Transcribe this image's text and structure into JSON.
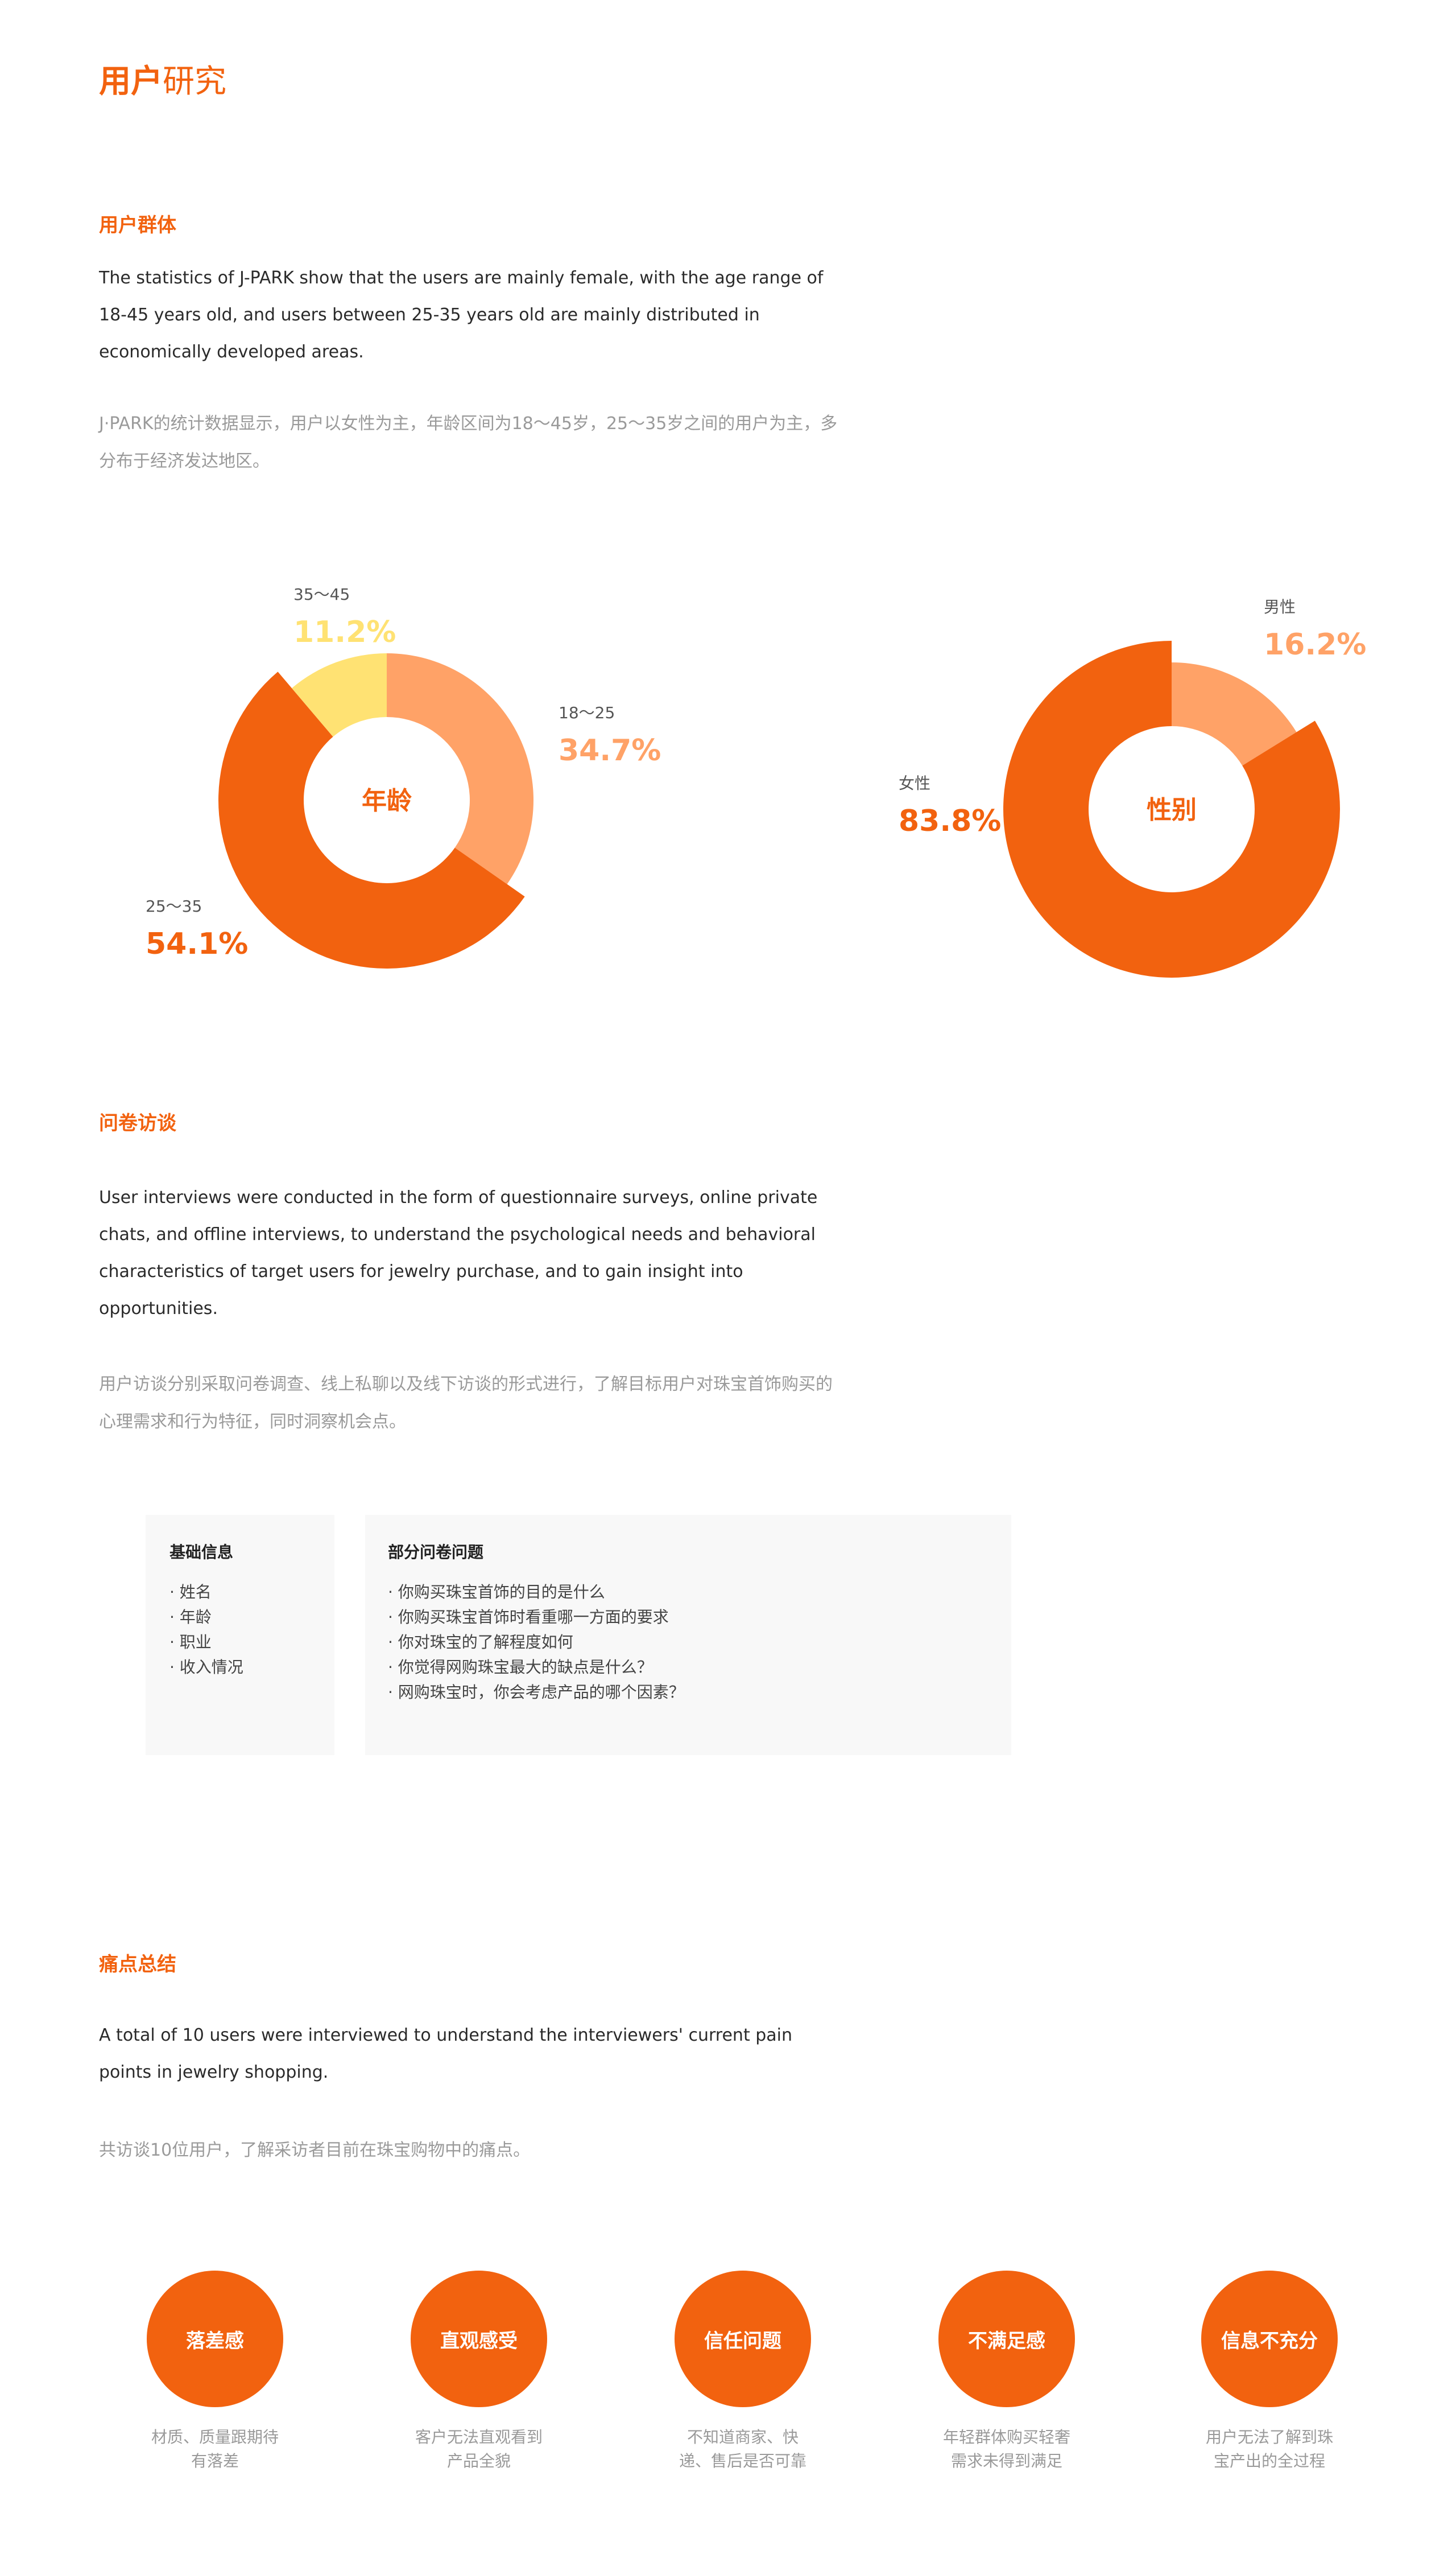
{
  "page": {
    "title_bold": "用户",
    "title_light": "研究"
  },
  "user_group": {
    "heading": "用户群体",
    "en": "The statistics of J-PARK show that the users are mainly female, with the age range of 18-45 years old, and users between 25-35 years old are mainly distributed in economically developed areas.",
    "cn": "J·PARK的统计数据显示，用户以女性为主，年龄区间为18～45岁，25～35岁之间的用户为主，多分布于经济发达地区。"
  },
  "colors": {
    "primary": "#F2620F",
    "light_orange": "#FFA267",
    "yellow": "#FFE273",
    "gray_text": "#9a9a9a",
    "card_bg": "#f8f8f8"
  },
  "chart_data": [
    {
      "type": "pie",
      "center_label": "年龄",
      "categories": [
        "18～25",
        "25～35",
        "35～45"
      ],
      "values": [
        34.7,
        54.1,
        11.2
      ],
      "value_labels": [
        "34.7%",
        "54.1%",
        "11.2%"
      ],
      "colors": [
        "#FFA267",
        "#F2620F",
        "#FFE273"
      ]
    },
    {
      "type": "pie",
      "center_label": "性别",
      "categories": [
        "男性",
        "女性"
      ],
      "values": [
        16.2,
        83.8
      ],
      "value_labels": [
        "16.2%",
        "83.8%"
      ],
      "colors": [
        "#FFA267",
        "#F2620F"
      ]
    }
  ],
  "interview": {
    "heading": "问卷访谈",
    "en": "User interviews were conducted in the form of questionnaire surveys, online private chats, and offline interviews, to understand the psychological needs and behavioral characteristics of target users for jewelry purchase, and to gain insight into opportunities.",
    "cn": "用户访谈分别采取问卷调查、线上私聊以及线下访谈的形式进行，了解目标用户对珠宝首饰购买的心理需求和行为特征，同时洞察机会点。",
    "basic_card": {
      "title": "基础信息",
      "items": [
        "· 姓名",
        "· 年龄",
        "· 职业",
        "· 收入情况"
      ]
    },
    "question_card": {
      "title": "部分问卷问题",
      "items": [
        "· 你购买珠宝首饰的目的是什么",
        "· 你购买珠宝首饰时看重哪一方面的要求",
        "· 你对珠宝的了解程度如何",
        "· 你觉得网购珠宝最大的缺点是什么？",
        "· 网购珠宝时，你会考虑产品的哪个因素？"
      ]
    }
  },
  "pain_points": {
    "heading": "痛点总结",
    "en": "A total of 10 users were interviewed to understand the interviewers' current pain points in jewelry shopping.",
    "cn": "共访谈10位用户，了解采访者目前在珠宝购物中的痛点。",
    "items": [
      {
        "label": "落差感",
        "desc1": "材质、质量跟期待",
        "desc2": "有落差"
      },
      {
        "label": "直观感受",
        "desc1": "客户无法直观看到",
        "desc2": "产品全貌"
      },
      {
        "label": "信任问题",
        "desc1": "不知道商家、快",
        "desc2": "递、售后是否可靠"
      },
      {
        "label": "不满足感",
        "desc1": "年轻群体购买轻奢",
        "desc2": "需求未得到满足"
      },
      {
        "label": "信息不充分",
        "desc1": "用户无法了解到珠",
        "desc2": "宝产出的全过程"
      }
    ]
  }
}
